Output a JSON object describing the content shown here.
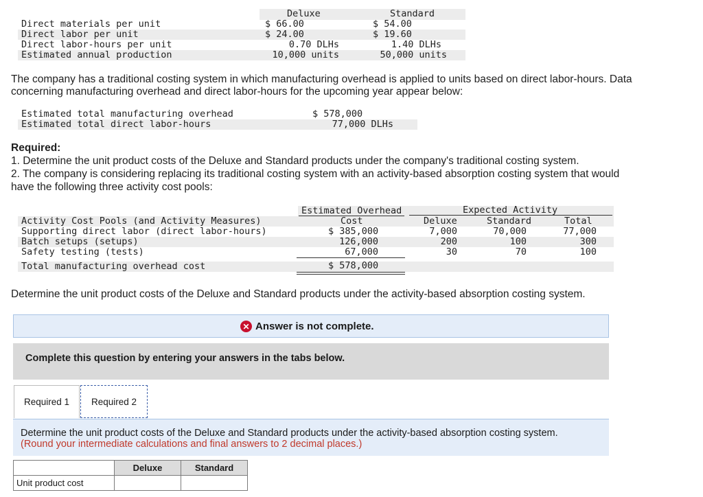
{
  "product_table": {
    "col_deluxe": "Deluxe",
    "col_standard": "Standard",
    "rows": [
      {
        "label": "Direct materials per unit",
        "deluxe": "$ 66.00",
        "standard": "$ 54.00"
      },
      {
        "label": "Direct labor per unit",
        "deluxe": "$ 24.00",
        "standard": "$ 19.60"
      },
      {
        "label": "Direct labor-hours per unit",
        "deluxe": "0.70 DLHs",
        "standard": "1.40 DLHs"
      },
      {
        "label": "Estimated annual production",
        "deluxe": "10,000 units",
        "standard": "50,000 units"
      }
    ]
  },
  "intro_text_1": "The company has a traditional costing system in which manufacturing overhead is applied to units based on direct labor-hours. Data",
  "intro_text_2": "concerning manufacturing overhead and direct labor-hours for the upcoming year appear below:",
  "overhead_table": {
    "rows": [
      {
        "label": "Estimated total manufacturing overhead",
        "value": "$ 578,000"
      },
      {
        "label": "Estimated total direct labor-hours",
        "value": "77,000 DLHs"
      }
    ]
  },
  "required": {
    "heading": "Required:",
    "item1": "1. Determine the unit product costs of the Deluxe and Standard products under the company's traditional costing system.",
    "item2a": "2. The company is considering replacing its traditional costing system with an activity-based absorption costing system that would",
    "item2b": "have the following three activity cost pools:"
  },
  "activity_table": {
    "header_overhead_1": "Estimated Overhead",
    "header_overhead_2": "Cost",
    "header_expected": "Expected Activity",
    "header_pools": "Activity Cost Pools (and Activity Measures)",
    "header_deluxe": "Deluxe",
    "header_standard": "Standard",
    "header_total": "Total",
    "rows": [
      {
        "label": "Supporting direct labor (direct labor-hours)",
        "cost": "$ 385,000",
        "deluxe": "7,000",
        "standard": "70,000",
        "total": "77,000"
      },
      {
        "label": "Batch setups (setups)",
        "cost": "126,000",
        "deluxe": "200",
        "standard": "100",
        "total": "300"
      },
      {
        "label": "Safety testing (tests)",
        "cost": "67,000",
        "deluxe": "30",
        "standard": "70",
        "total": "100"
      }
    ],
    "total_label": "Total manufacturing overhead cost",
    "total_cost": "$ 578,000"
  },
  "determine_text": "Determine the unit product costs of the Deluxe and Standard products under the activity-based absorption costing system.",
  "banner_text": "Answer is not complete.",
  "panel_text": "Complete this question by entering your answers in the tabs below.",
  "tabs": [
    "Required 1",
    "Required 2"
  ],
  "instructions": {
    "line1": "Determine the unit product costs of the Deluxe and Standard products under the activity-based absorption costing system.",
    "line2": "(Round your intermediate calculations and final answers to 2 decimal places.)"
  },
  "answer_table": {
    "col_deluxe": "Deluxe",
    "col_standard": "Standard",
    "row_label": "Unit product cost",
    "deluxe_value": "",
    "standard_value": ""
  },
  "colors": {
    "error_red": "#c8102e",
    "note_red": "#c0392b",
    "panel_blue": "#e4edf9",
    "panel_gray": "#d9d9d9"
  }
}
